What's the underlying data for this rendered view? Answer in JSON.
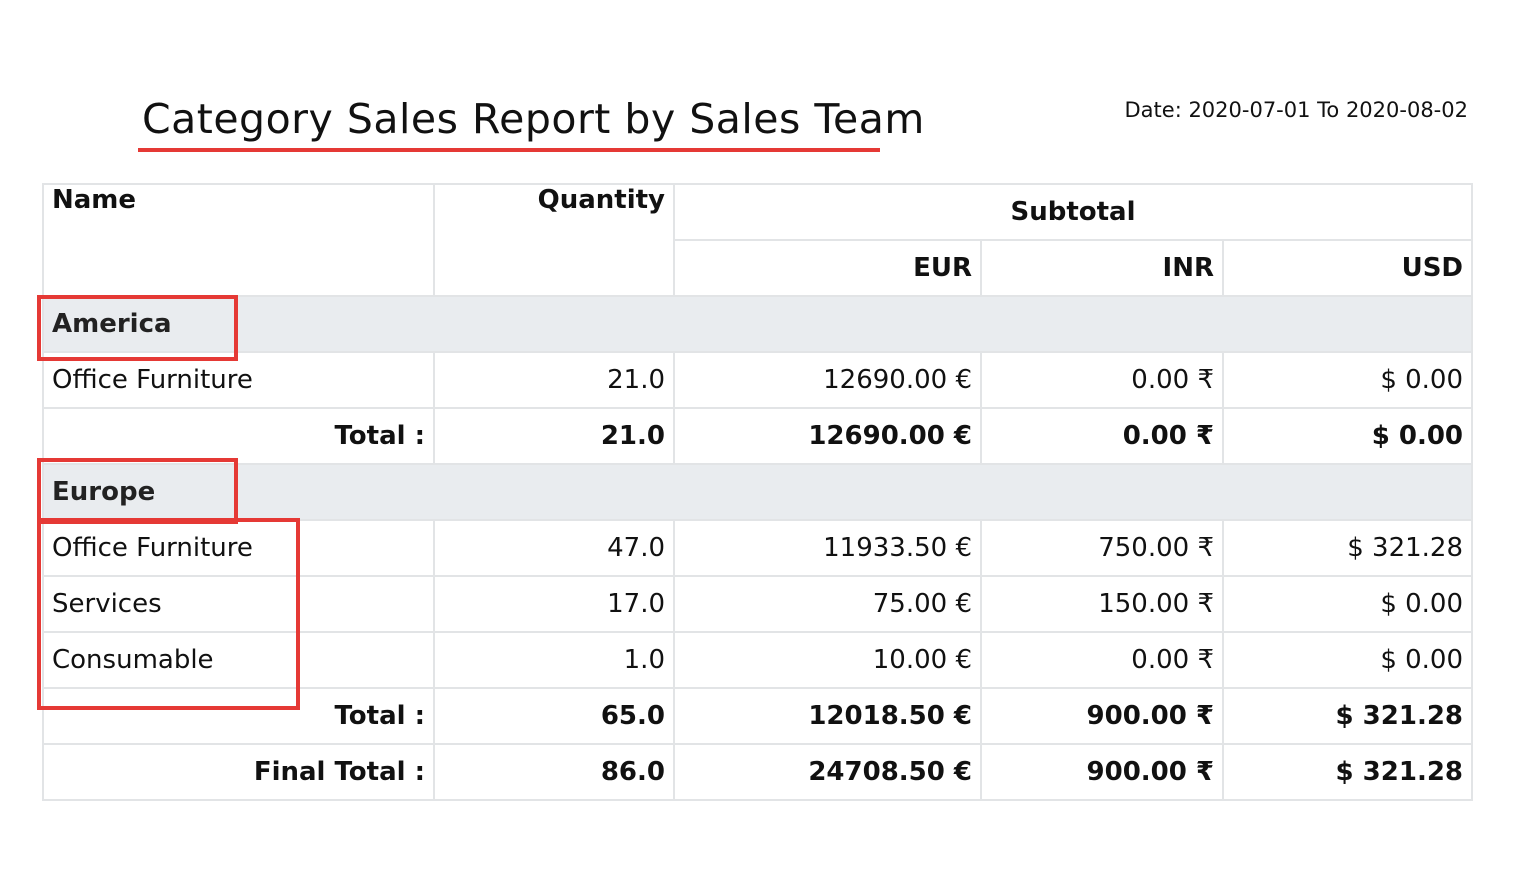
{
  "report": {
    "title": "Category Sales Report by Sales Team",
    "date_range": "Date: 2020-07-01 To 2020-08-02"
  },
  "table": {
    "headers": {
      "name": "Name",
      "quantity": "Quantity",
      "subtotal": "Subtotal",
      "currencies": [
        "EUR",
        "INR",
        "USD"
      ]
    },
    "groups": [
      {
        "name": "America",
        "rows": [
          {
            "name": "Office Furniture",
            "quantity": "21.0",
            "eur": "12690.00 €",
            "inr": "0.00 ₹",
            "usd": "$ 0.00"
          }
        ],
        "total": {
          "label": "Total :",
          "quantity": "21.0",
          "eur": "12690.00 €",
          "inr": "0.00 ₹",
          "usd": "$ 0.00"
        }
      },
      {
        "name": "Europe",
        "rows": [
          {
            "name": "Office Furniture",
            "quantity": "47.0",
            "eur": "11933.50 €",
            "inr": "750.00 ₹",
            "usd": "$ 321.28"
          },
          {
            "name": "Services",
            "quantity": "17.0",
            "eur": "75.00 €",
            "inr": "150.00 ₹",
            "usd": "$ 0.00"
          },
          {
            "name": "Consumable",
            "quantity": "1.0",
            "eur": "10.00 €",
            "inr": "0.00 ₹",
            "usd": "$ 0.00"
          }
        ],
        "total": {
          "label": "Total :",
          "quantity": "65.0",
          "eur": "12018.50 €",
          "inr": "900.00 ₹",
          "usd": "$ 321.28"
        }
      }
    ],
    "final_total": {
      "label": "Final Total :",
      "quantity": "86.0",
      "eur": "24708.50 €",
      "inr": "900.00 ₹",
      "usd": "$ 321.28"
    }
  },
  "colors": {
    "highlight": "#e53935",
    "group_row_bg": "#e9ecef",
    "border": "#e2e4e6"
  }
}
